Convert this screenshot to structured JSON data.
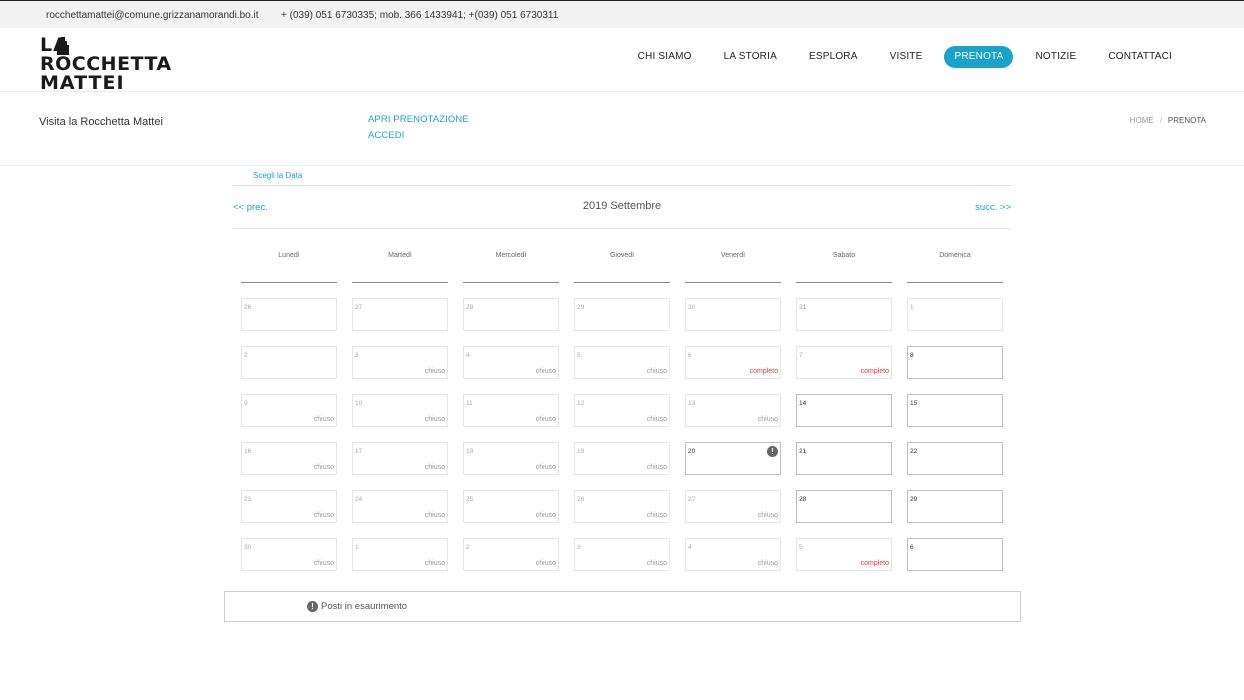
{
  "topbar": {
    "email": "rocchettamattei@comune.grizzanamorandi.bo.it",
    "phones": "+ (039) 051 6730335; mob. 366 1433941; +(039) 051 6730311"
  },
  "logo": {
    "line1": "LA",
    "line2": "ROCCHETTA",
    "line3": "MATTEI"
  },
  "nav": [
    {
      "label": "CHI SIAMO",
      "active": false
    },
    {
      "label": "LA STORIA",
      "active": false
    },
    {
      "label": "ESPLORA",
      "active": false
    },
    {
      "label": "VISITE",
      "active": false
    },
    {
      "label": "PRENOTA",
      "active": true
    },
    {
      "label": "NOTIZIE",
      "active": false
    },
    {
      "label": "CONTATTACI",
      "active": false
    }
  ],
  "accent_color": "#1aa3c9",
  "full_color": "#e03a3a",
  "subheader": {
    "title": "Visita la Rocchetta Mattei",
    "links": [
      "APRI PRENOTAZIONE",
      "ACCEDI"
    ],
    "breadcrumb": [
      "HOME",
      "PRENOTA"
    ]
  },
  "calendar": {
    "tab_label": "Scegli la Data",
    "prev_label": "<< prec.",
    "next_label": "succ. >>",
    "month_title": "2019 Settembre",
    "weekdays": [
      "Lunedì",
      "Martedì",
      "Mercoledì",
      "Giovedì",
      "Venerdì",
      "Sabato",
      "Domenica"
    ],
    "weeks": [
      [
        {
          "day": "26",
          "status": "",
          "open": false,
          "warning": false
        },
        {
          "day": "27",
          "status": "",
          "open": false,
          "warning": false
        },
        {
          "day": "28",
          "status": "",
          "open": false,
          "warning": false
        },
        {
          "day": "29",
          "status": "",
          "open": false,
          "warning": false
        },
        {
          "day": "30",
          "status": "",
          "open": false,
          "warning": false
        },
        {
          "day": "31",
          "status": "",
          "open": false,
          "warning": false
        },
        {
          "day": "1",
          "status": "",
          "open": false,
          "warning": false
        }
      ],
      [
        {
          "day": "2",
          "status": "",
          "open": false,
          "warning": false
        },
        {
          "day": "3",
          "status": "chiuso",
          "open": false,
          "warning": false
        },
        {
          "day": "4",
          "status": "chiuso",
          "open": false,
          "warning": false
        },
        {
          "day": "5",
          "status": "chiuso",
          "open": false,
          "warning": false
        },
        {
          "day": "6",
          "status": "completo",
          "open": false,
          "warning": false
        },
        {
          "day": "7",
          "status": "completo",
          "open": false,
          "warning": false
        },
        {
          "day": "8",
          "status": "",
          "open": true,
          "warning": false
        }
      ],
      [
        {
          "day": "9",
          "status": "chiuso",
          "open": false,
          "warning": false
        },
        {
          "day": "10",
          "status": "chiuso",
          "open": false,
          "warning": false
        },
        {
          "day": "11",
          "status": "chiuso",
          "open": false,
          "warning": false
        },
        {
          "day": "12",
          "status": "chiuso",
          "open": false,
          "warning": false
        },
        {
          "day": "13",
          "status": "chiuso",
          "open": false,
          "warning": false
        },
        {
          "day": "14",
          "status": "",
          "open": true,
          "warning": false
        },
        {
          "day": "15",
          "status": "",
          "open": true,
          "warning": false
        }
      ],
      [
        {
          "day": "16",
          "status": "chiuso",
          "open": false,
          "warning": false
        },
        {
          "day": "17",
          "status": "chiuso",
          "open": false,
          "warning": false
        },
        {
          "day": "18",
          "status": "chiuso",
          "open": false,
          "warning": false
        },
        {
          "day": "19",
          "status": "chiuso",
          "open": false,
          "warning": false
        },
        {
          "day": "20",
          "status": "",
          "open": true,
          "warning": true
        },
        {
          "day": "21",
          "status": "",
          "open": true,
          "warning": false
        },
        {
          "day": "22",
          "status": "",
          "open": true,
          "warning": false
        }
      ],
      [
        {
          "day": "23",
          "status": "chiuso",
          "open": false,
          "warning": false
        },
        {
          "day": "24",
          "status": "chiuso",
          "open": false,
          "warning": false
        },
        {
          "day": "25",
          "status": "chiuso",
          "open": false,
          "warning": false
        },
        {
          "day": "26",
          "status": "chiuso",
          "open": false,
          "warning": false
        },
        {
          "day": "27",
          "status": "chiuso",
          "open": false,
          "warning": false
        },
        {
          "day": "28",
          "status": "",
          "open": true,
          "warning": false
        },
        {
          "day": "29",
          "status": "",
          "open": true,
          "warning": false
        }
      ],
      [
        {
          "day": "30",
          "status": "chiuso",
          "open": false,
          "warning": false
        },
        {
          "day": "1",
          "status": "chiuso",
          "open": false,
          "warning": false
        },
        {
          "day": "2",
          "status": "chiuso",
          "open": false,
          "warning": false
        },
        {
          "day": "3",
          "status": "chiuso",
          "open": false,
          "warning": false
        },
        {
          "day": "4",
          "status": "chiuso",
          "open": false,
          "warning": false
        },
        {
          "day": "5",
          "status": "completo",
          "open": false,
          "warning": false
        },
        {
          "day": "6",
          "status": "",
          "open": true,
          "warning": false
        }
      ]
    ],
    "warning_glyph": "!"
  },
  "legend": {
    "icon_glyph": "!",
    "text": "Posti in esaurimento"
  }
}
